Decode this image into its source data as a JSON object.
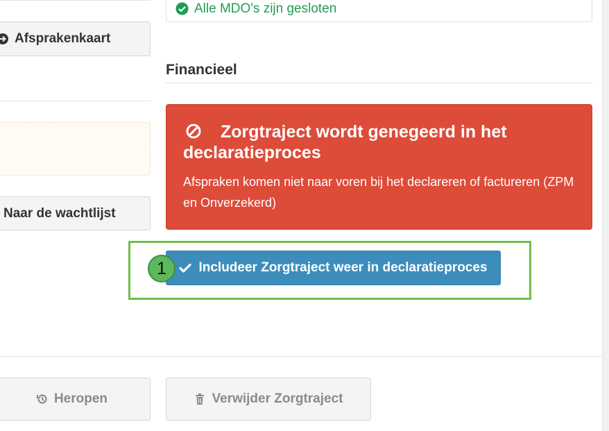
{
  "left": {
    "afsprakenkaart_label": "Afsprakenkaart",
    "wachtlijst_label": "Naar de wachtlijst",
    "heropen_label": "Heropen"
  },
  "status": {
    "mdo_text": "Alle MDO's zijn gesloten",
    "mdo_color": "#1f9d55"
  },
  "financieel": {
    "title": "Financieel",
    "alert_title": "Zorgtraject wordt genegeerd in het declaratieproces",
    "alert_body": "Afspraken komen niet naar voren bij het declareren of factureren (ZPM en Onverzekerd)",
    "alert_color": "#dd4b39",
    "include_button": "Includeer Zorgtraject weer in declaratieproces",
    "include_button_color": "#3c8dbc"
  },
  "annotation": {
    "step_number": "1",
    "highlight_color": "#6cbf48"
  },
  "footer": {
    "delete_label": "Verwijder Zorgtraject"
  },
  "icons": {
    "afsprakenkaart": "arrow-circle-icon",
    "mdo": "check-circle-icon",
    "alert": "ban-icon",
    "include": "check-icon",
    "heropen": "history-icon",
    "delete": "trash-icon"
  }
}
